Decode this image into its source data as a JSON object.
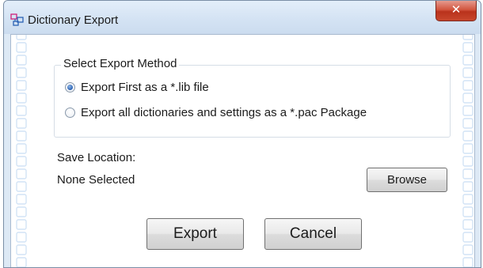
{
  "window": {
    "title": "Dictionary Export",
    "close_label": "✕",
    "title_icon": "dictionary-export-icon"
  },
  "export_method": {
    "group_label": "Select Export Method",
    "options": [
      {
        "label": "Export First as a *.lib file",
        "selected": true
      },
      {
        "label": "Export all dictionaries and settings as a *.pac Package",
        "selected": false
      }
    ]
  },
  "save_location": {
    "label": "Save Location:",
    "value": "None Selected",
    "browse_label": "Browse"
  },
  "actions": {
    "export_label": "Export",
    "cancel_label": "Cancel"
  },
  "colors": {
    "frame": "#dde9f5",
    "close_button": "#c8472c",
    "radio_selected": "#2a62b4",
    "side_pattern": "#d9e8f7"
  }
}
